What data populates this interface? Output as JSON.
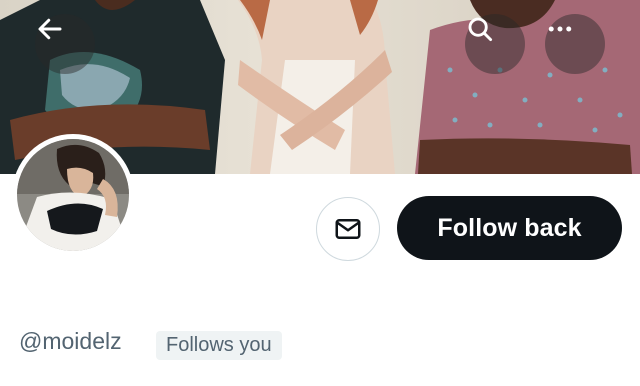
{
  "banner": {
    "back_icon": "arrow-left-icon",
    "search_icon": "search-icon",
    "more_icon": "more-horizontal-icon"
  },
  "profile": {
    "handle": "@moidelz",
    "follows_you_label": "Follows you"
  },
  "actions": {
    "message_icon": "envelope-icon",
    "follow_label": "Follow back"
  },
  "colors": {
    "follow_button_bg": "#0f1419",
    "follow_button_text": "#ffffff",
    "secondary_text": "#536471",
    "badge_bg": "#eff3f4",
    "border": "#cfd9de"
  }
}
